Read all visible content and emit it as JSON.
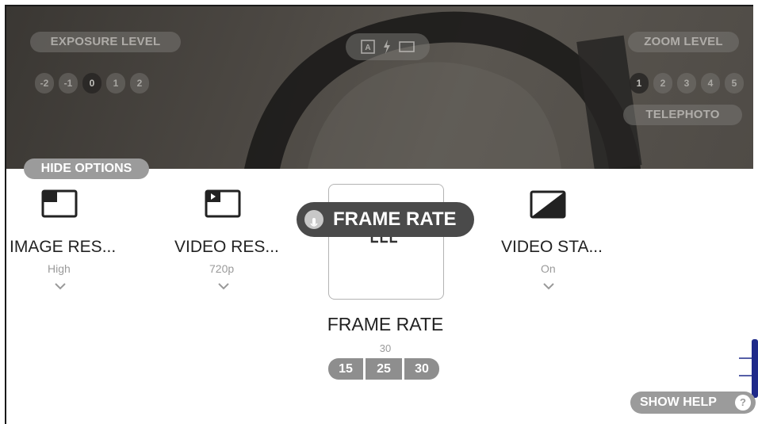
{
  "viewfinder": {
    "exposure_label": "EXPOSURE LEVEL",
    "exposure_levels": [
      "-2",
      "-1",
      "0",
      "1",
      "2"
    ],
    "exposure_selected": "0",
    "zoom_label": "ZOOM LEVEL",
    "zoom_levels": [
      "1",
      "2",
      "3",
      "4",
      "5"
    ],
    "zoom_selected": "1",
    "telephoto_label": "TELEPHOTO",
    "icons": [
      "focus-icon",
      "flash-icon",
      "aspect-ratio-icon"
    ]
  },
  "hide_options_label": "HIDE OPTIONS",
  "options": {
    "image_resolution": {
      "title": "IMAGE RES...",
      "value": "High",
      "icon": "image-resolution-icon"
    },
    "video_resolution": {
      "title": "VIDEO RES...",
      "value": "720p",
      "icon": "video-resolution-icon"
    },
    "frame_rate": {
      "tooltip": "FRAME RATE",
      "title": "FRAME RATE",
      "value": "30",
      "choices": [
        "15",
        "25",
        "30"
      ],
      "icon": "frame-rate-icon"
    },
    "video_stabilization": {
      "title": "VIDEO STA...",
      "value": "On",
      "icon": "video-stabilization-icon"
    }
  },
  "show_help_label": "SHOW HELP",
  "show_help_icon": "?",
  "colors": {
    "pill_gray": "#9b9b9b",
    "tooltip_dark": "#4a4a4a",
    "accent_blue": "#1f2a8a"
  }
}
